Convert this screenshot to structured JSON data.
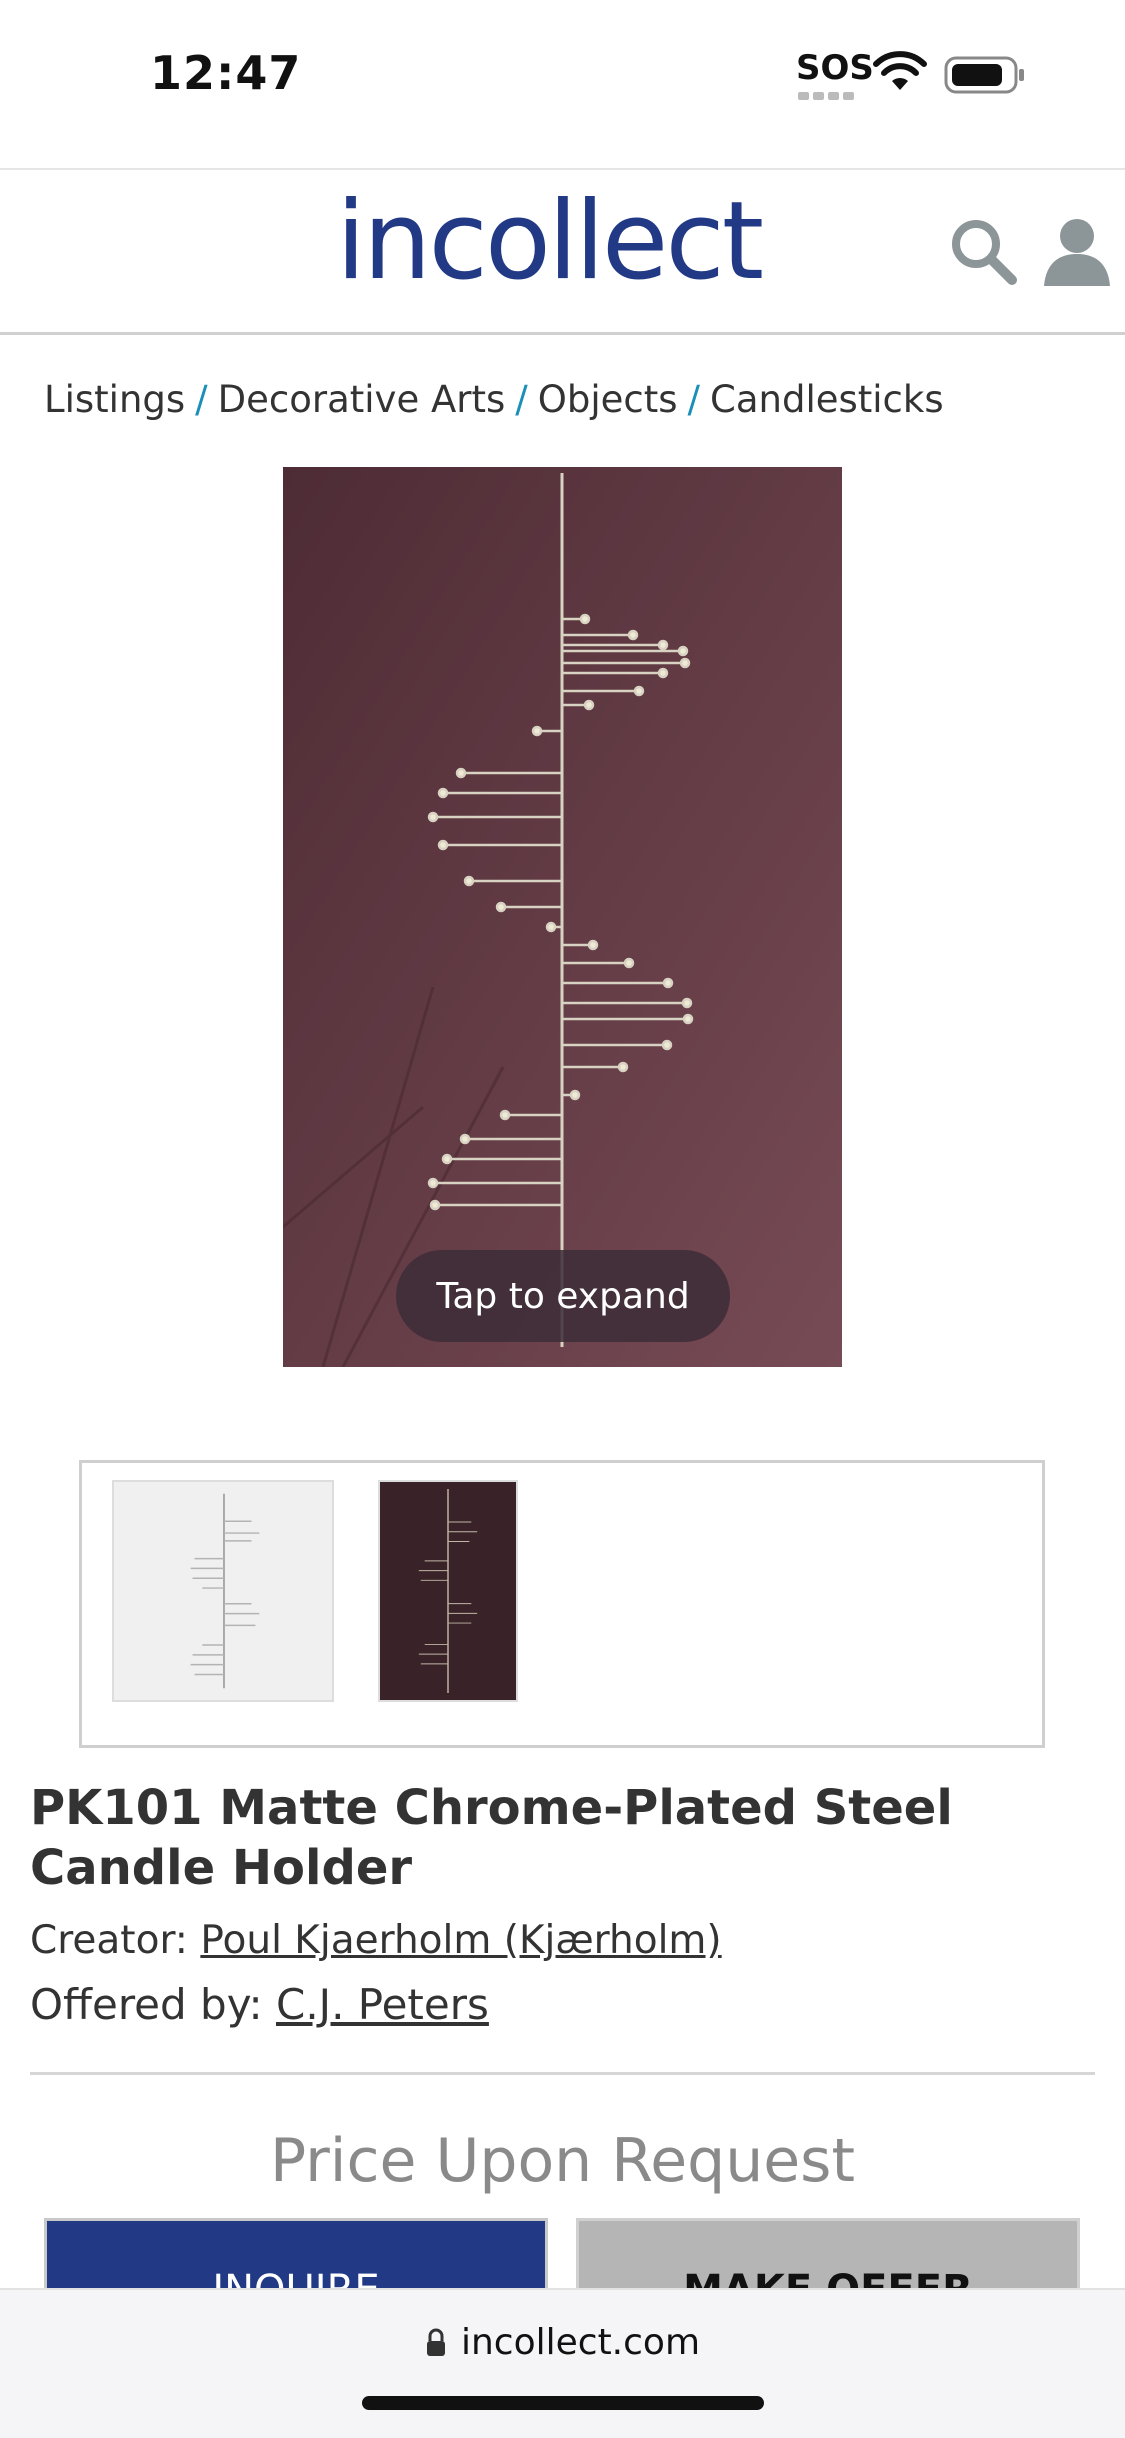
{
  "status_bar": {
    "time": "12:47",
    "carrier": "SOS",
    "icons": [
      "wifi-icon",
      "battery-icon"
    ]
  },
  "header": {
    "logo": "incollect",
    "logo_color": "#223a86",
    "icons": [
      "search-icon",
      "user-icon"
    ]
  },
  "breadcrumb": [
    "Listings",
    "Decorative Arts",
    "Objects",
    "Candlesticks"
  ],
  "image": {
    "tap_label": "Tap to expand",
    "background_color": "#5f3a44"
  },
  "product": {
    "title": "PK101 Matte Chrome-Plated Steel Candle Holder",
    "creator_label": "Creator:",
    "creator_name": "Poul Kjaerholm (Kjærholm)",
    "offered_label": "Offered by:",
    "offered_name": "C.J. Peters",
    "price": "Price Upon Request"
  },
  "actions": {
    "inquire": "INQUIRE",
    "make_offer": "MAKE OFFER",
    "inquire_color": "#223a86"
  },
  "browser": {
    "url": "incollect.com"
  }
}
